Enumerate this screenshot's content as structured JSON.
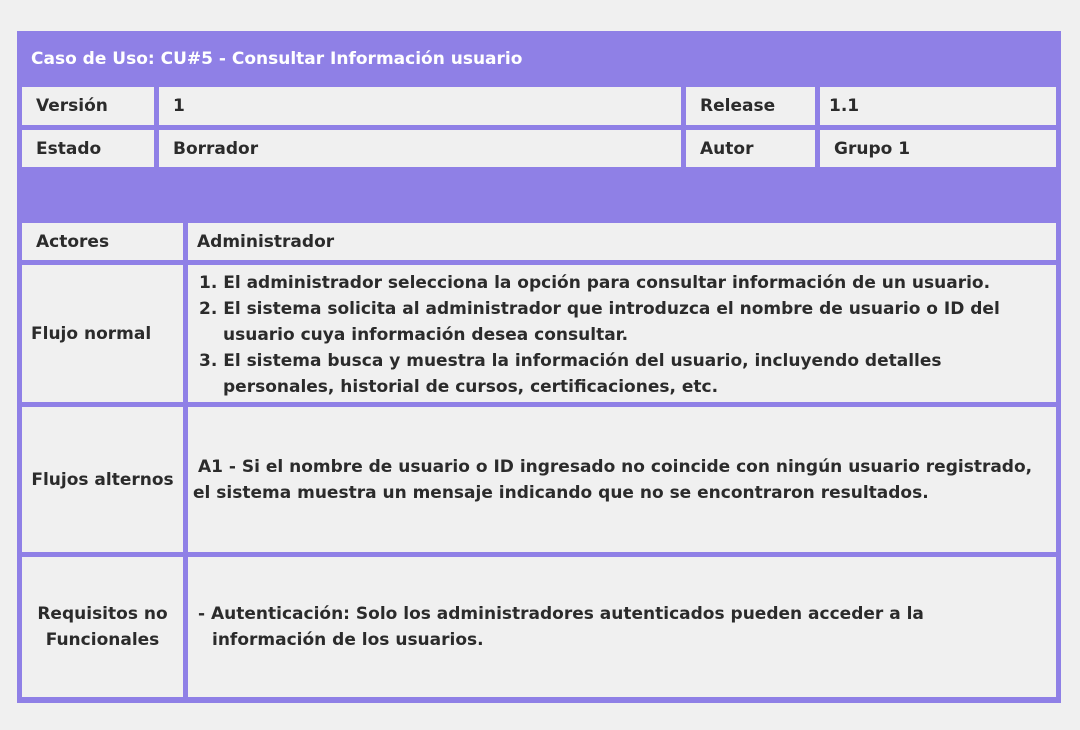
{
  "title": "Caso de Uso: CU#5 - Consultar Información usuario",
  "header": {
    "version_label": "Versión",
    "version_value": "1",
    "release_label": "Release",
    "release_value": "1.1",
    "estado_label": "Estado",
    "estado_value": "Borrador",
    "autor_label": "Autor",
    "autor_value": "Grupo 1"
  },
  "actores": {
    "label": "Actores",
    "value": "Administrador"
  },
  "flujo_normal": {
    "label": "Flujo normal",
    "steps": [
      "1. El administrador selecciona la opción para consultar información de un usuario.",
      "2. El sistema solicita al administrador que introduzca el nombre de usuario o ID del usuario cuya información desea consultar.",
      "3. El sistema busca y muestra la información del usuario, incluyendo detalles personales, historial de cursos, certificaciones, etc."
    ]
  },
  "flujos_alternos": {
    "label": "Flujos alternos",
    "text": "A1 - Si el nombre de usuario o ID ingresado no coincide con ningún usuario registrado, el sistema muestra un mensaje indicando que no se encontraron resultados."
  },
  "requisitos": {
    "label": "Requisitos no Funcionales",
    "text": "- Autenticación: Solo los administradores autenticados pueden acceder a la información de los usuarios."
  },
  "colors": {
    "frame": "#8f80e6",
    "cell": "#f0f0f0",
    "text": "#2b2b2b",
    "title": "#ffffff"
  }
}
